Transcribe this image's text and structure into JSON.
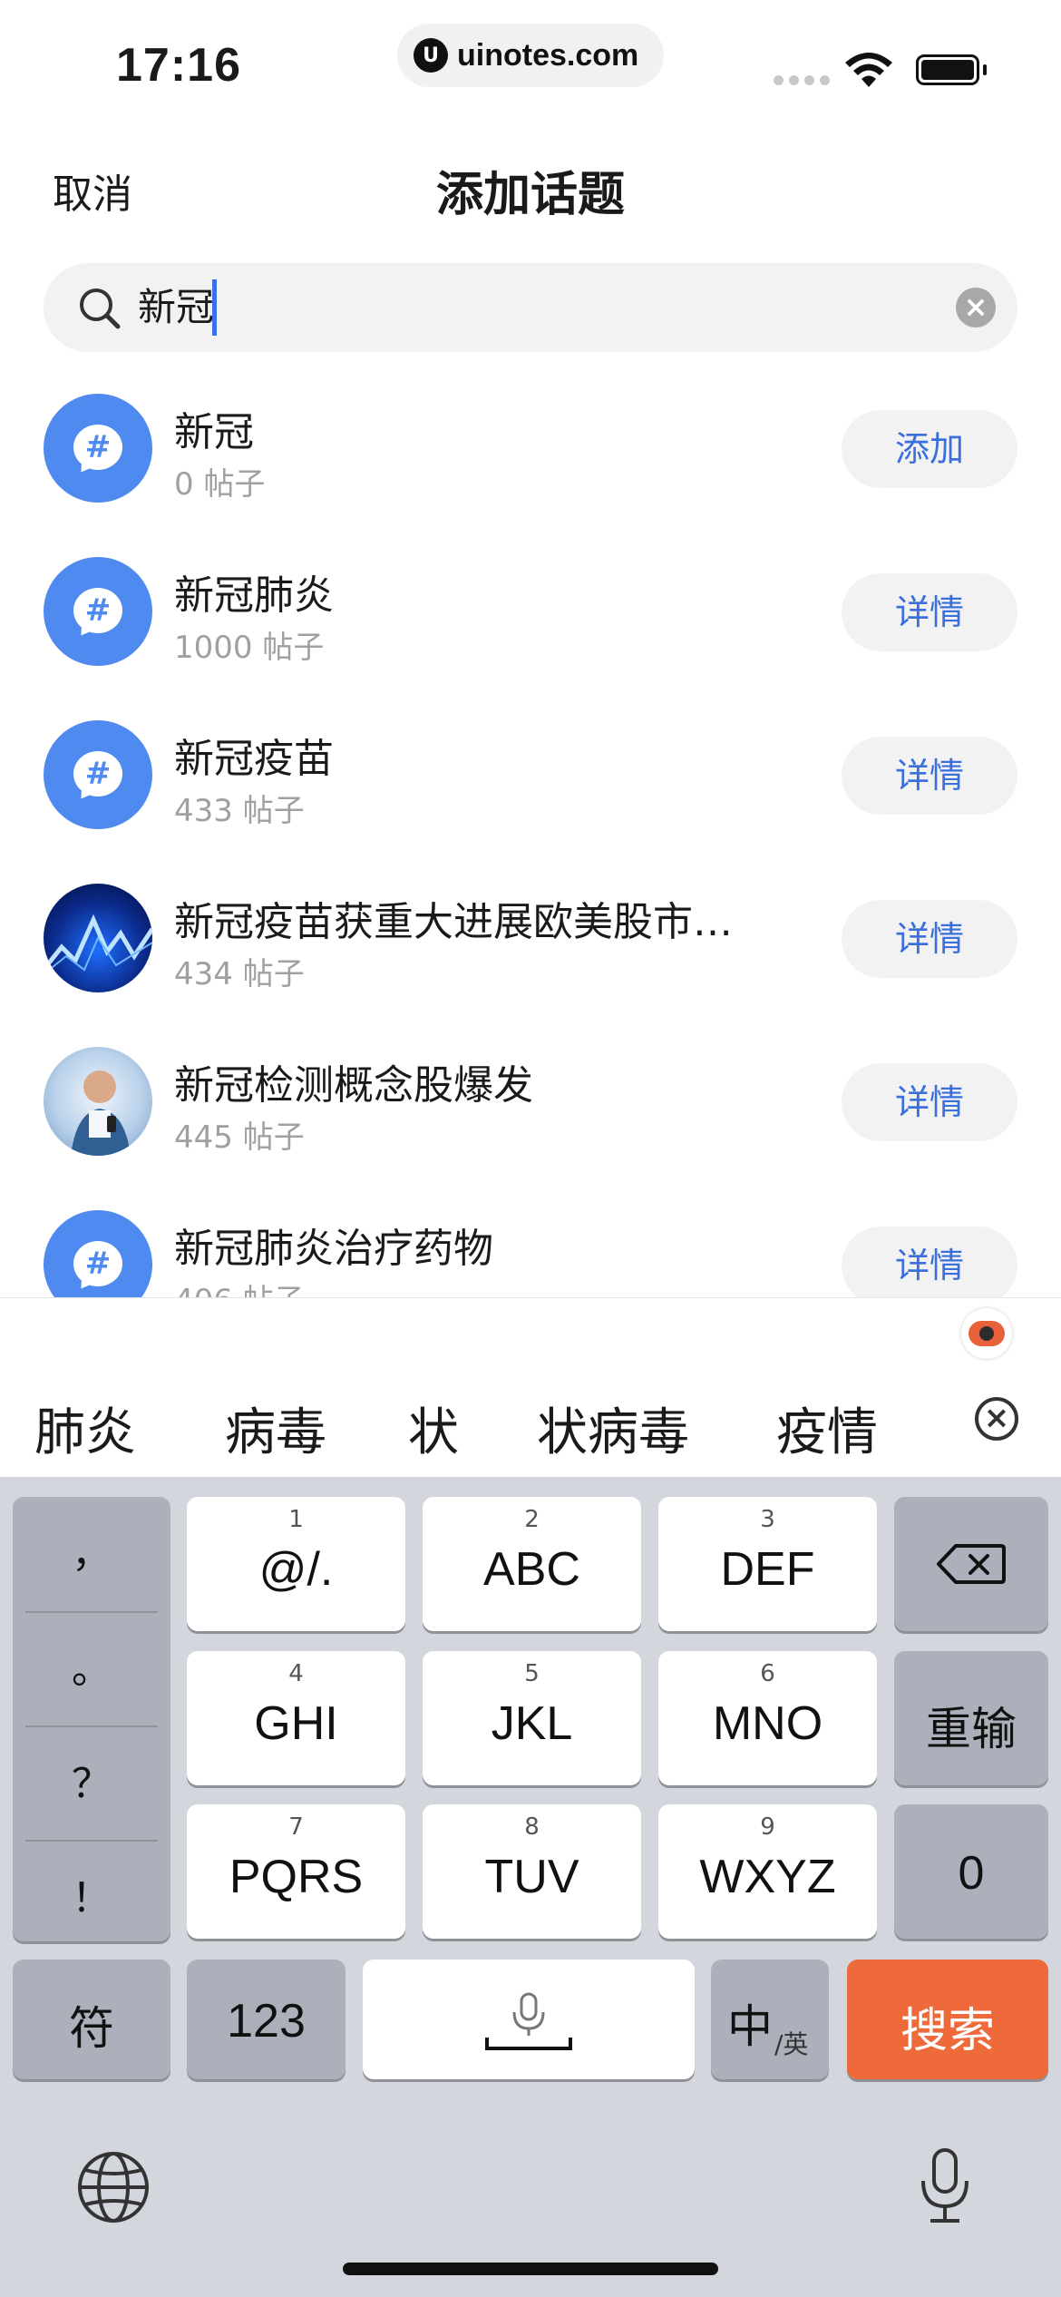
{
  "status_bar": {
    "time": "17:16",
    "url": "uinotes.com"
  },
  "header": {
    "cancel_label": "取消",
    "title": "添加话题"
  },
  "search": {
    "value": "新冠"
  },
  "topics": [
    {
      "name": "新冠",
      "count": "0 帖子",
      "action": "添加",
      "avatar": "hashtag-icon"
    },
    {
      "name": "新冠肺炎",
      "count": "1000 帖子",
      "action": "详情",
      "avatar": "hashtag-icon"
    },
    {
      "name": "新冠疫苗",
      "count": "433 帖子",
      "action": "详情",
      "avatar": "hashtag-icon"
    },
    {
      "name": "新冠疫苗获重大进展欧美股市…",
      "count": "434 帖子",
      "action": "详情",
      "avatar": "stock-chart-image"
    },
    {
      "name": "新冠检测概念股爆发",
      "count": "445 帖子",
      "action": "详情",
      "avatar": "lab-scientist-image"
    },
    {
      "name": "新冠肺炎治疗药物",
      "count": "406 帖子",
      "action": "详情",
      "avatar": "hashtag-icon"
    }
  ],
  "candidates": [
    "肺炎",
    "病毒",
    "状",
    "状病毒",
    "疫情"
  ],
  "keyboard": {
    "punctuation": [
      "，",
      "。",
      "？",
      "！"
    ],
    "keys": [
      {
        "num": "1",
        "label": "@/."
      },
      {
        "num": "2",
        "label": "ABC"
      },
      {
        "num": "3",
        "label": "DEF"
      },
      {
        "num": "4",
        "label": "GHI"
      },
      {
        "num": "5",
        "label": "JKL"
      },
      {
        "num": "6",
        "label": "MNO"
      },
      {
        "num": "7",
        "label": "PQRS"
      },
      {
        "num": "8",
        "label": "TUV"
      },
      {
        "num": "9",
        "label": "WXYZ"
      }
    ],
    "reenter_label": "重输",
    "zero_label": "0",
    "symbols_label": "符",
    "numbers_label": "123",
    "lang_main": "中",
    "lang_sub": "/英",
    "search_label": "搜索",
    "search_color": "#ef6a3a"
  },
  "colors": {
    "accent": "#3a6fdc",
    "avatar_blue": "#4f8af0"
  }
}
